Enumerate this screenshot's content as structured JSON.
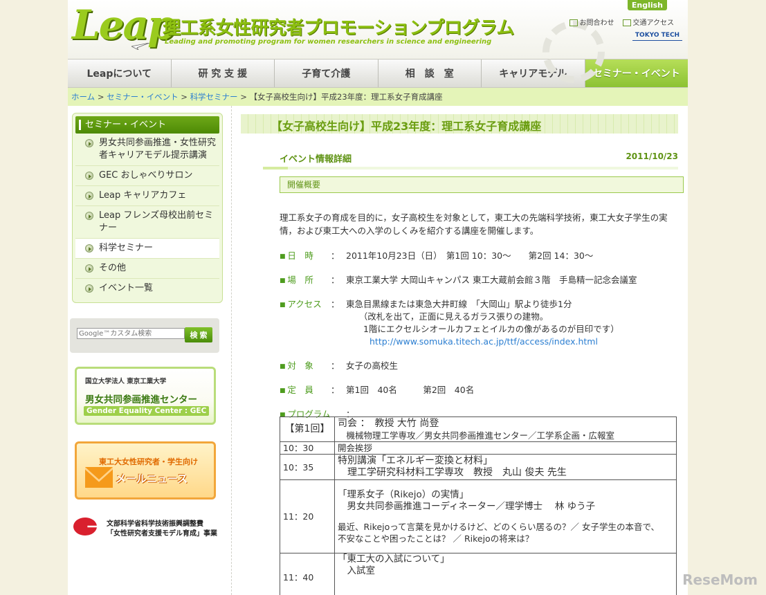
{
  "header": {
    "logo_text": "Leap",
    "title": "理工系女性研究者プロモーションプログラム",
    "subtitle": "Leading and promoting program for women researchers in science and engineering",
    "english_label": "English",
    "contact_label": "お問合わせ",
    "access_label": "交通アクセス",
    "university_logo": "TOKYO TECH"
  },
  "nav": [
    {
      "label": "Leapについて"
    },
    {
      "label": "研 究 支 援"
    },
    {
      "label": "子育て介護"
    },
    {
      "label": "相　談　室"
    },
    {
      "label": "キャリアモデル"
    },
    {
      "label": "セミナー・イベント",
      "active": true
    }
  ],
  "breadcrumb": {
    "items": [
      "ホーム",
      "セミナー・イベント",
      "科学セミナー"
    ],
    "current": "【女子高校生向け】平成23年度：理工系女子育成講座",
    "separator": ">"
  },
  "sidebar": {
    "heading": "セミナー・イベント",
    "items": [
      {
        "label": "男女共同参画推進・女性研究者キャリアモデル提示講演"
      },
      {
        "label": "GEC おしゃべりサロン"
      },
      {
        "label": "Leap キャリアカフェ"
      },
      {
        "label": "Leap フレンズ母校出前セミナー"
      },
      {
        "label": "科学セミナー",
        "current": true
      },
      {
        "label": "その他"
      },
      {
        "label": "イベント一覧"
      }
    ],
    "search_placeholder": "Google™カスタム検索",
    "search_button": "検 索",
    "gec_banner": {
      "line1": "国立大学法人 東京工業大学",
      "line2": "男女共同参画推進センター",
      "line3": "Gender Equality Center : GEC"
    },
    "mail_banner": {
      "line1": "東工大女性研究者・学生向け",
      "line2": "メールニュース"
    },
    "mext": {
      "line1": "文部科学省科学技術振興調整費",
      "line2": "「女性研究者支援モデル育成」事業"
    }
  },
  "main": {
    "title": "【女子高校生向け】平成23年度：理工系女子育成講座",
    "section_label": "イベント情報詳細",
    "date": "2011/10/23",
    "overview_label": "開催概要",
    "intro": "理工系女子の育成を目的に，女子高校生を対象として，東工大の先端科学技術，東工大女子学生の実情，および東工大への入学のしくみを紹介する講座を開催します。",
    "details": [
      {
        "label": "日　時",
        "lines": [
          "2011年10月23日（日）　第1回 10：30〜　　第2回 14：30〜"
        ]
      },
      {
        "label": "場　所",
        "lines": [
          "東京工業大学 大岡山キャンパス 東工大蔵前会館３階　手島精一記念会議室"
        ]
      },
      {
        "label": "アクセス",
        "lines": [
          "東急目黒線または東急大井町線　「大岡山」駅より徒歩1分",
          "　　（改札を出て，正面に見えるガラス張りの建物。",
          "　　1階にエクセルシオールカフェとイルカの像があるのが目印です）"
        ],
        "url": "http://www.somuka.titech.ac.jp/ttf/access/index.html"
      },
      {
        "label": "対　象",
        "lines": [
          "女子の高校生"
        ]
      },
      {
        "label": "定　員",
        "lines": [
          "第1回　40名　　　第2回　40名"
        ]
      }
    ],
    "program_label": "プログラム",
    "program": [
      {
        "time": "【第1回】",
        "lines": [
          "司会 ：　教授 大竹 尚登",
          "　機械物理工学専攻／男女共同参画推進センター／工学系企画・広報室"
        ]
      },
      {
        "time": "10：30",
        "lines": [
          "開会挨拶"
        ]
      },
      {
        "time": "10：35",
        "lines": [
          "特別講演「エネルギー変換と材料」",
          "　理工学研究科材料工学専攻　教授　丸山 俊夫 先生"
        ]
      },
      {
        "time": "11：20",
        "lines": [
          "「理系女子（Rikejo）の実情」",
          "　男女共同参画推進コーディネーター／理学博士　 林 ゆう子",
          "",
          "最近、Rikejoって言葉を見かけるけど、どのくらい居るの？／ 女子学生の本音で、",
          "不安なことや困ったことは？ ／ Rikejoの将来は？"
        ]
      },
      {
        "time": "11：40",
        "lines": [
          "「東工大の入試について」",
          "　入試室",
          ""
        ]
      }
    ]
  },
  "watermark": "ReseMom",
  "colors": {
    "accent_green": "#8cc233",
    "breadcrumb_bg": "#e4f4b8",
    "link_blue": "#2b7ed1"
  }
}
